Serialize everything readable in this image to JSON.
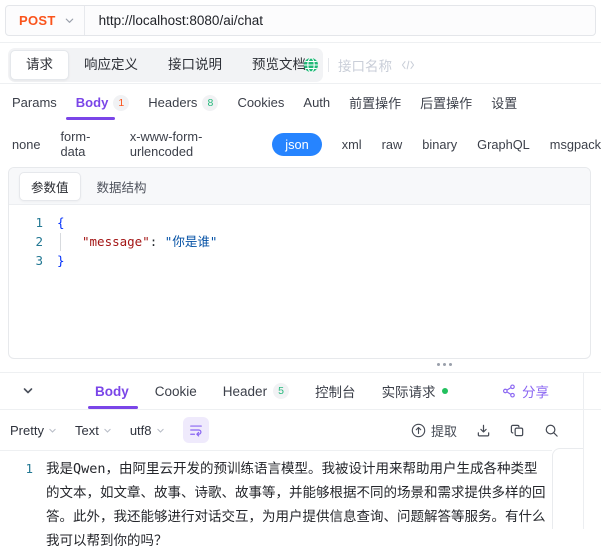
{
  "url_bar": {
    "method": "POST",
    "url": "http://localhost:8080/ai/chat"
  },
  "doc_tabs": {
    "items": [
      {
        "label": "请求"
      },
      {
        "label": "响应定义"
      },
      {
        "label": "接口说明"
      },
      {
        "label": "预览文档"
      }
    ],
    "api_name_placeholder": "接口名称"
  },
  "request_tabs": {
    "items": [
      {
        "label": "Params"
      },
      {
        "label": "Body",
        "badge": "1"
      },
      {
        "label": "Headers",
        "badge": "8"
      },
      {
        "label": "Cookies"
      },
      {
        "label": "Auth"
      },
      {
        "label": "前置操作"
      },
      {
        "label": "后置操作"
      },
      {
        "label": "设置"
      }
    ]
  },
  "body_types": {
    "items": [
      {
        "label": "none"
      },
      {
        "label": "form-data"
      },
      {
        "label": "x-www-form-urlencoded"
      },
      {
        "label": "json"
      },
      {
        "label": "xml"
      },
      {
        "label": "raw"
      },
      {
        "label": "binary"
      },
      {
        "label": "GraphQL"
      },
      {
        "label": "msgpack"
      }
    ],
    "active": "json"
  },
  "editor": {
    "tabs": [
      {
        "label": "参数值"
      },
      {
        "label": "数据结构"
      }
    ],
    "line_numbers": [
      "1",
      "2",
      "3"
    ],
    "code": {
      "open_brace": "{",
      "key": "\"message\"",
      "colon": ": ",
      "value": "\"你是谁\"",
      "close_brace": "}"
    }
  },
  "response": {
    "tabs": [
      {
        "label": "Body"
      },
      {
        "label": "Cookie"
      },
      {
        "label": "Header",
        "badge": "5"
      },
      {
        "label": "控制台"
      },
      {
        "label": "实际请求"
      }
    ],
    "share_label": "分享",
    "toolbar": {
      "format": "Pretty",
      "view": "Text",
      "encoding": "utf8",
      "extract_label": "提取"
    },
    "body": {
      "line_number": "1",
      "text": "我是Qwen，由阿里云开发的预训练语言模型。我被设计用来帮助用户生成各种类型的文本，如文章、故事、诗歌、故事等，并能够根据不同的场景和需求提供多样的回答。此外，我还能够进行对话交互，为用户提供信息查询、问题解答等服务。有什么我可以帮到你的吗？"
    }
  },
  "colors": {
    "method_orange": "#fa541c",
    "accent_purple": "#7a45e8",
    "accent_blue": "#2684ff",
    "success_green": "#22c05e"
  }
}
